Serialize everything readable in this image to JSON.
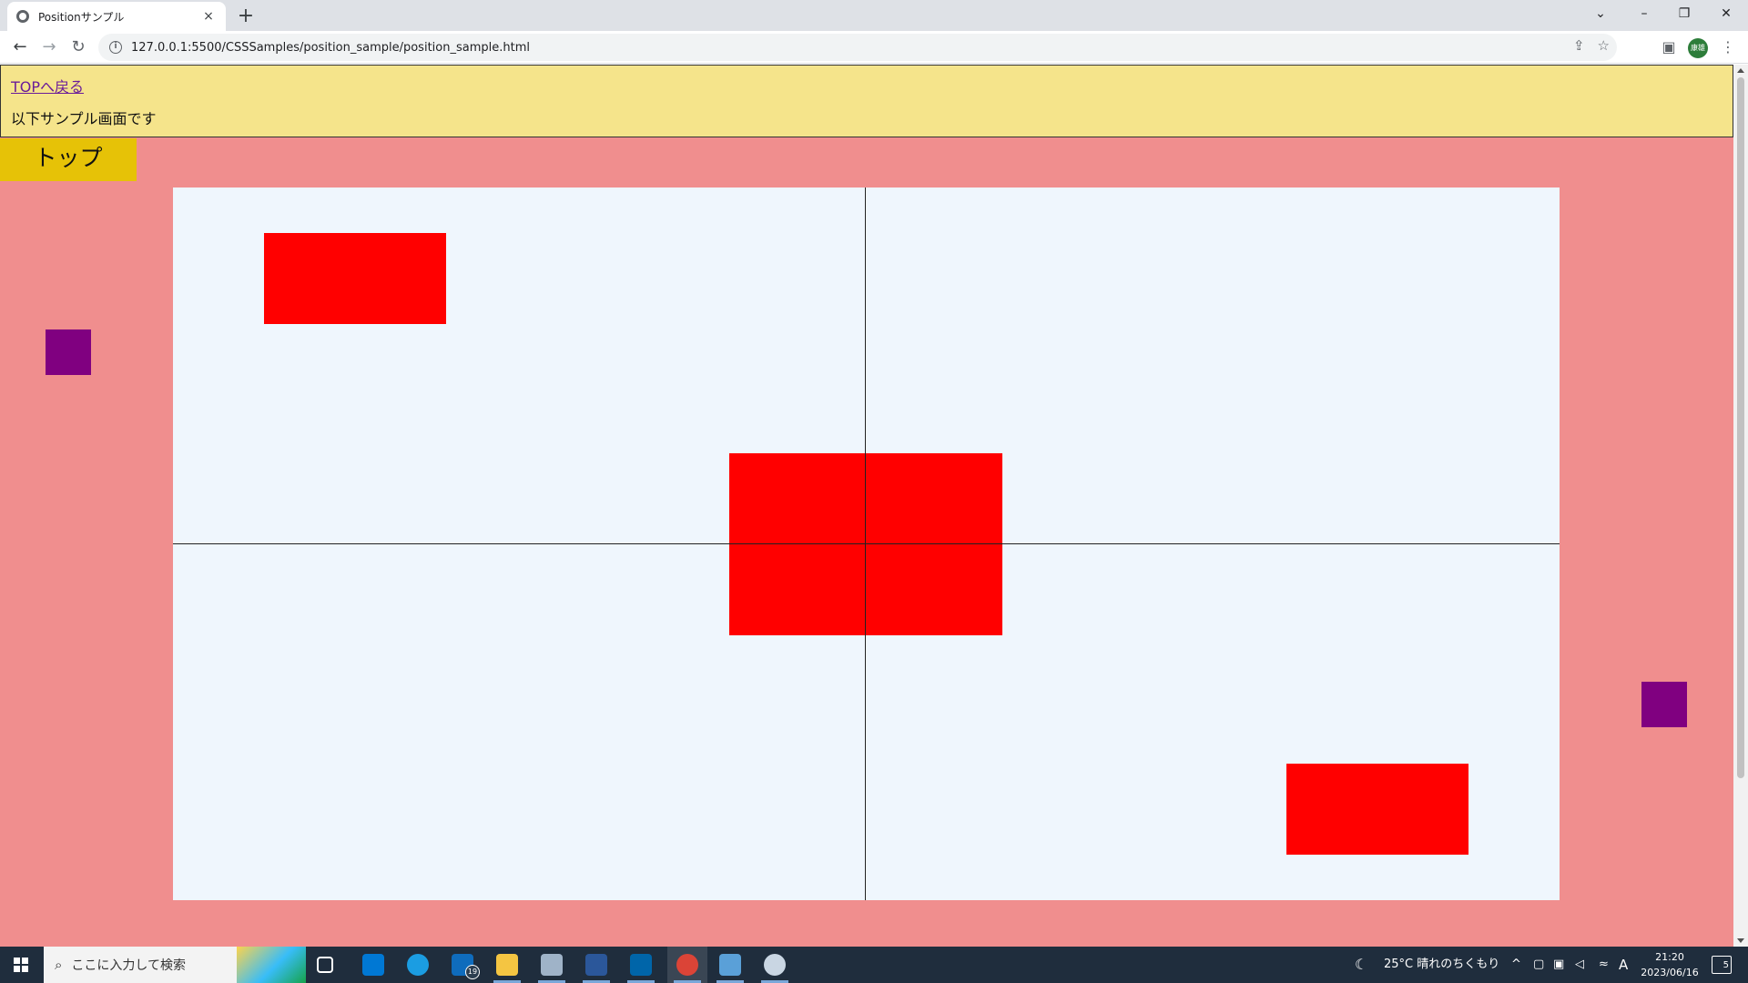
{
  "browser": {
    "tab_title": "Positionサンプル",
    "tab_close": "×",
    "new_tab": "+",
    "url": "127.0.0.1:5500/CSSSamples/position_sample/position_sample.html",
    "profile_label": "康雄"
  },
  "page": {
    "top_link": "TOPへ戻る",
    "sample_text": "以下サンプル画面です",
    "top_block": "トップ",
    "colors": {
      "background": "#f08e8e",
      "header": "#f5e48b",
      "top_block": "#e6c207",
      "stage": "#eff6fd",
      "red_box": "#ff0000",
      "purple_box": "#800080"
    }
  },
  "taskbar": {
    "search_placeholder": "ここに入力して検索",
    "mail_badge": "19",
    "weather": "25°C 晴れのちくもり",
    "time": "21:20",
    "date": "2023/06/16",
    "ime": "A",
    "notifications": "5"
  }
}
